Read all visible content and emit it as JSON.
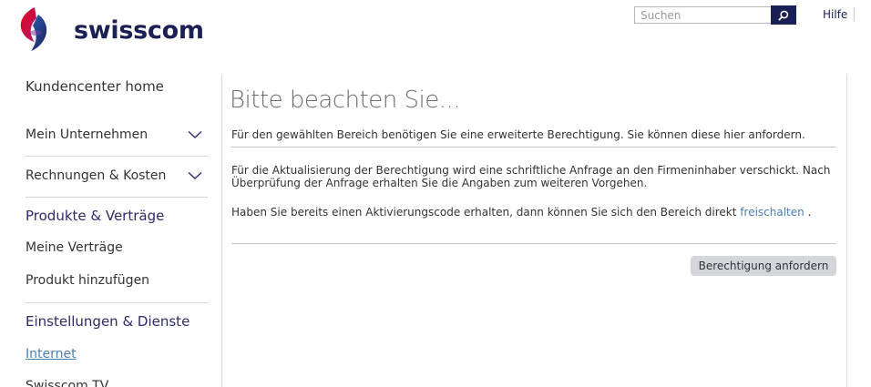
{
  "brand": {
    "name": "swisscom"
  },
  "header": {
    "search_placeholder": "Suchen",
    "help_label": "Hilfe"
  },
  "sidebar": {
    "home_label": "Kundencenter home",
    "accordions": [
      {
        "label": "Mein Unternehmen"
      },
      {
        "label": "Rechnungen & Kosten"
      }
    ],
    "sections": [
      {
        "title": "Produkte & Verträge",
        "links": [
          "Meine Verträge",
          "Produkt hinzufügen"
        ]
      },
      {
        "title": "Einstellungen & Dienste",
        "links": [
          "Internet",
          "Swisscom TV"
        ]
      }
    ],
    "active_link": "Internet"
  },
  "main": {
    "title": "Bitte beachten Sie...",
    "intro": "Für den gewählten Bereich benötigen Sie eine erweiterte Berechtigung. Sie können diese hier anfordern.",
    "info_line1": "Für die Aktualisierung der Berechtigung wird eine schriftliche Anfrage an den Firmeninhaber verschickt. Nach",
    "info_line2": "Überprüfung der Anfrage erhalten Sie die Angaben zum weiteren Vorgehen.",
    "code_text": "Haben Sie bereits einen Aktivierungscode erhalten, dann können Sie sich den Bereich direkt",
    "code_link": "freischalten",
    "code_end": " .",
    "request_button": "Berechtigung anfordern"
  },
  "colors": {
    "brand_navy": "#1a1f55",
    "link_blue": "#4a7fb5",
    "section_purple": "#2e2a6b",
    "button_gray": "#d3d7dc"
  },
  "icons": [
    "swisscom-logo-icon",
    "search-icon",
    "chevron-down-icon"
  ]
}
